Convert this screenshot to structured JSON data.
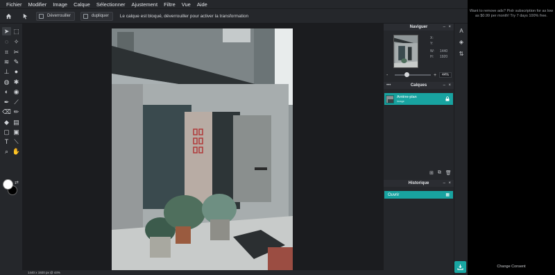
{
  "menu": [
    "Fichier",
    "Modifier",
    "Image",
    "Calque",
    "Sélectionner",
    "Ajustement",
    "Filtre",
    "Vue",
    "Aide"
  ],
  "options": {
    "unlock_label": "Déverrouiller",
    "duplicate_label": "dupliquer",
    "lock_message": "Le calque est bloqué, déverrouiller pour activer la transformation"
  },
  "navigator": {
    "title": "Naviguer",
    "x_label": "X:",
    "y_label": "Y:",
    "w_label": "W:",
    "w_value": "1440",
    "h_label": "H:",
    "h_value": "1920",
    "zoom_minus": "-",
    "zoom_plus": "+",
    "zoom": "44%"
  },
  "layers": {
    "title": "Calques",
    "more": "•••",
    "items": [
      {
        "name": "Arrière-plan",
        "type": "image"
      }
    ]
  },
  "history": {
    "title": "Historique",
    "items": [
      {
        "label": "Ouvrir"
      }
    ]
  },
  "panel_controls": {
    "minimize": "–",
    "close": "×"
  },
  "status": "1440 x 1920 px @ 44%",
  "ad": {
    "text": "Want to remove ads? Pixlr subscription for as low as $0.99 per month! Try 7 days 100% free.",
    "consent": "Change Consent"
  },
  "colors": {
    "accent": "#19a7a3",
    "panel": "#25272b",
    "canvas": "#1b1c1f"
  },
  "icons": {
    "home": "home-icon",
    "move": "move-icon",
    "marquee": "marquee-icon",
    "download": "download-icon",
    "lock": "lock-icon"
  }
}
